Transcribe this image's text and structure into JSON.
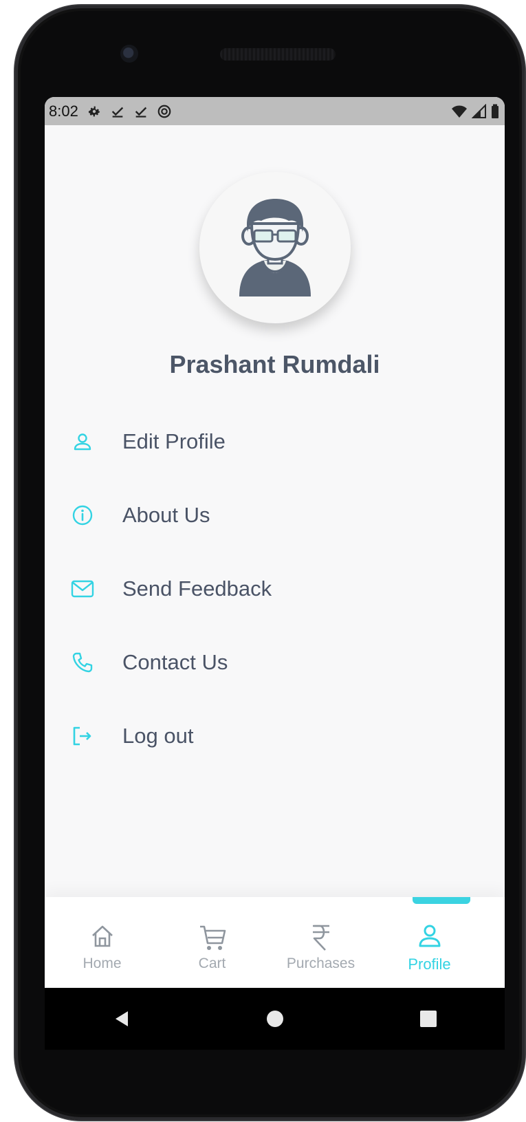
{
  "status_bar": {
    "time": "8:02"
  },
  "profile": {
    "name": "Prashant Rumdali"
  },
  "menu": [
    {
      "label": "Edit Profile",
      "icon": "user-icon"
    },
    {
      "label": "About Us",
      "icon": "info-icon"
    },
    {
      "label": "Send Feedback",
      "icon": "mail-icon"
    },
    {
      "label": "Contact Us",
      "icon": "phone-icon"
    },
    {
      "label": "Log out",
      "icon": "logout-icon"
    }
  ],
  "bottom_nav": [
    {
      "label": "Home",
      "icon": "home-icon",
      "active": false
    },
    {
      "label": "Cart",
      "icon": "cart-icon",
      "active": false
    },
    {
      "label": "Purchases",
      "icon": "rupee-icon",
      "active": false
    },
    {
      "label": "Profile",
      "icon": "user-icon",
      "active": true
    }
  ],
  "colors": {
    "accent": "#33d3e3",
    "text": "#4a5366",
    "inactive": "#a3a9b0"
  }
}
